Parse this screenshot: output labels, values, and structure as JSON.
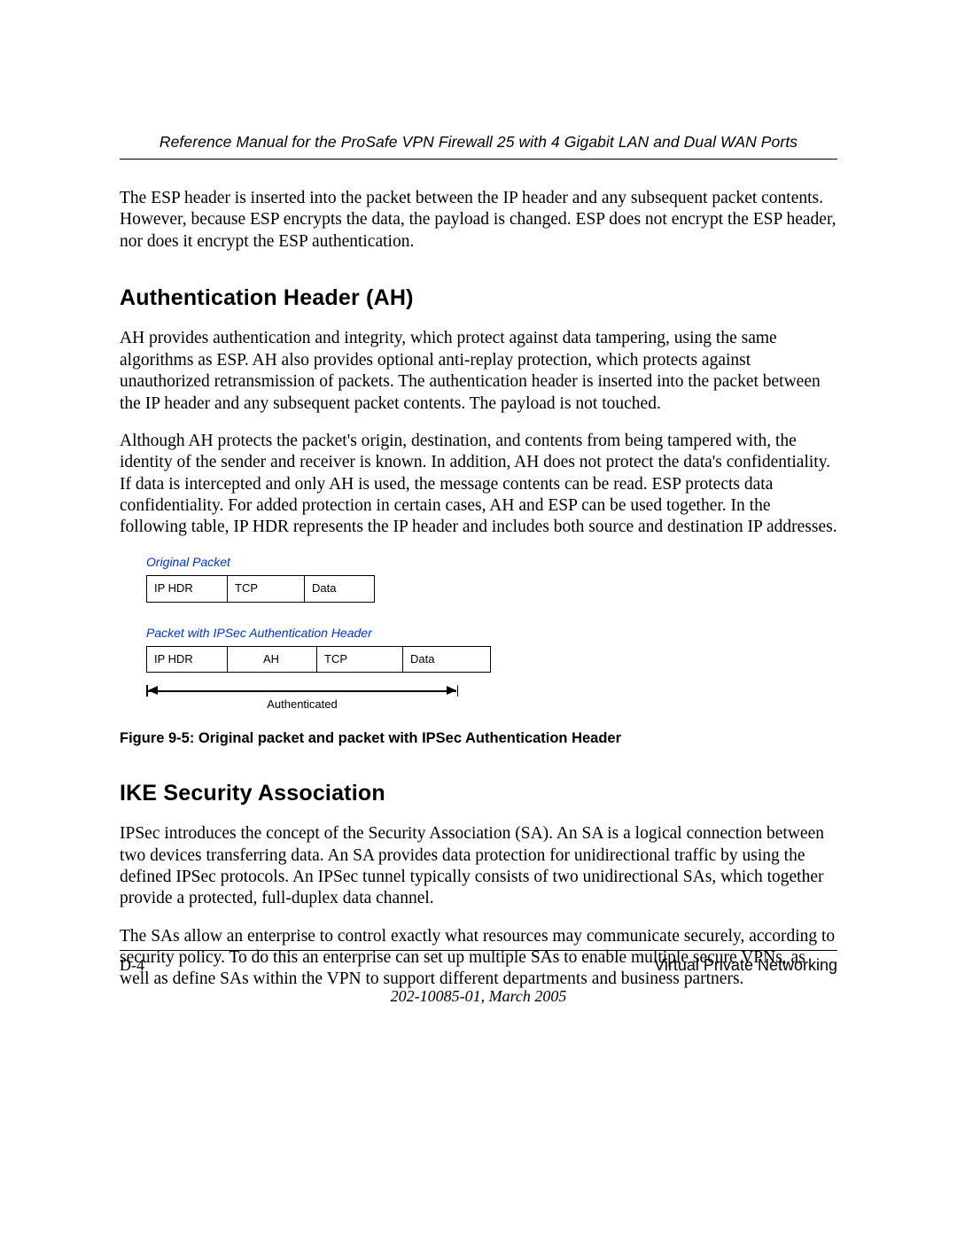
{
  "header": {
    "running_title": "Reference Manual for the ProSafe VPN Firewall 25 with 4 Gigabit LAN and Dual WAN Ports"
  },
  "paragraphs": {
    "intro": "The ESP header is inserted into the packet between the IP header and any subsequent packet contents. However, because ESP encrypts the data, the payload is changed. ESP does not encrypt the ESP header, nor does it encrypt the ESP authentication."
  },
  "section_ah": {
    "heading": "Authentication Header (AH)",
    "p1": "AH provides authentication and integrity, which protect against data tampering, using the same algorithms as ESP. AH also provides optional anti-replay protection, which protects against unauthorized retransmission of packets. The authentication header is inserted into the packet between the IP header and any subsequent packet contents. The payload is not touched.",
    "p2": "Although AH protects the packet's origin, destination, and contents from being tampered with, the identity of the sender and receiver is known. In addition, AH does not protect the data's confidentiality. If data is intercepted and only AH is used, the message contents can be read. ESP protects data confidentiality. For added protection in certain cases, AH and ESP can be used together. In the following table, IP HDR represents the IP header and includes both source and destination IP addresses."
  },
  "figure": {
    "label_original": "Original Packet",
    "original_cells": [
      "IP HDR",
      "TCP",
      "Data"
    ],
    "label_ipsec": "Packet with IPSec Authentication Header",
    "ipsec_cells": [
      "IP HDR",
      "AH",
      "TCP",
      "Data"
    ],
    "arrow_label": "Authenticated",
    "caption": "Figure 9-5:  Original packet and packet with IPSec Authentication Header"
  },
  "section_ike": {
    "heading": "IKE Security Association",
    "p1": "IPSec introduces the concept of the Security Association (SA). An SA is a logical connection between two devices transferring data. An SA provides data protection for unidirectional traffic by using the defined IPSec protocols. An IPSec tunnel typically consists of two unidirectional SAs, which together provide a protected, full-duplex data channel.",
    "p2": "The SAs allow an enterprise to control exactly what resources may communicate securely, according to security policy. To do this an enterprise can set up multiple SAs to enable multiple secure VPNs, as well as define SAs within the VPN to support different departments and business partners."
  },
  "footer": {
    "page_number": "D-4",
    "section_name": "Virtual Private Networking",
    "doc_id": "202-10085-01, March 2005"
  },
  "chart_data": [
    {
      "type": "table",
      "title": "Original Packet",
      "columns": [
        "IP HDR",
        "TCP",
        "Data"
      ]
    },
    {
      "type": "table",
      "title": "Packet with IPSec Authentication Header",
      "columns": [
        "IP HDR",
        "AH",
        "TCP",
        "Data"
      ],
      "annotation": "Authenticated span covers entire packet"
    }
  ]
}
